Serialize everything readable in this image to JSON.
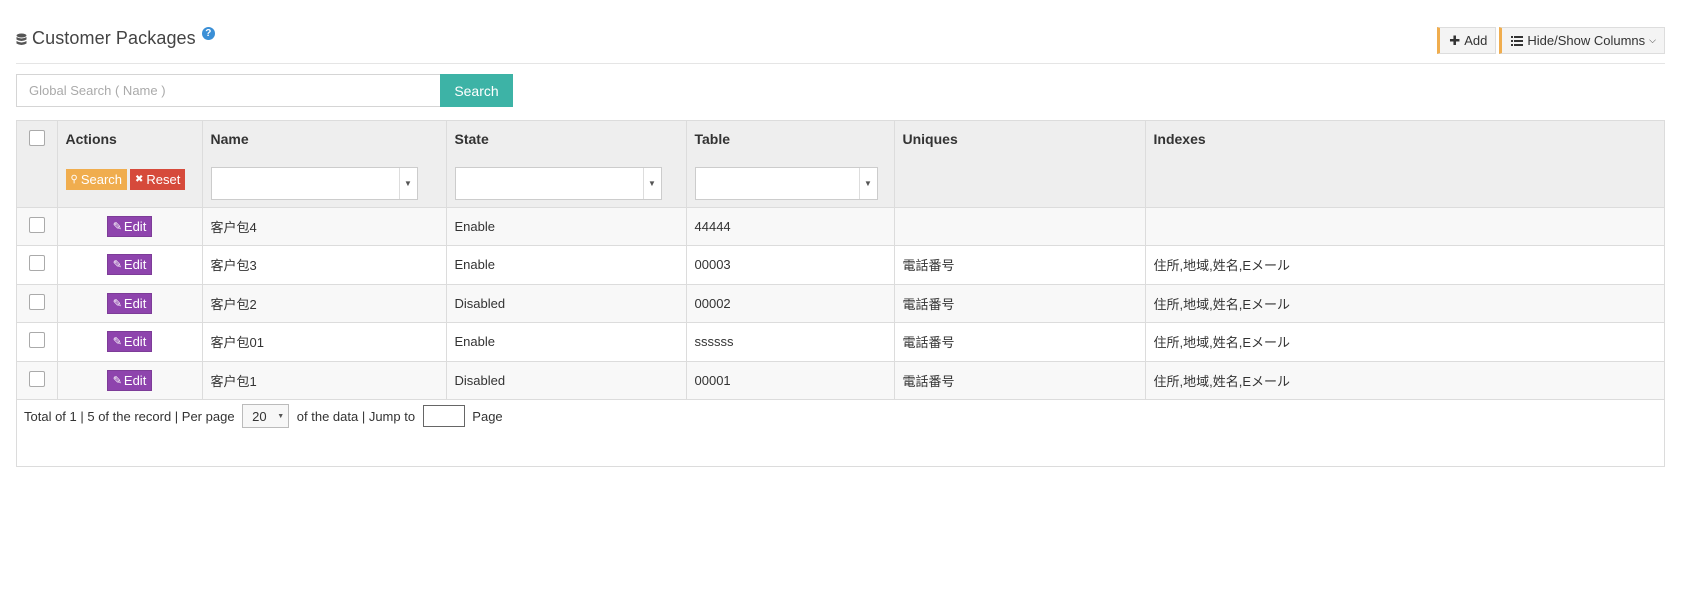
{
  "header": {
    "title": "Customer Packages",
    "help_symbol": "?",
    "add_label": "Add",
    "columns_label": "Hide/Show Columns"
  },
  "search": {
    "placeholder": "Global Search ( Name )",
    "button_label": "Search"
  },
  "table": {
    "columns": {
      "actions": "Actions",
      "name": "Name",
      "state": "State",
      "table": "Table",
      "uniques": "Uniques",
      "indexes": "Indexes"
    },
    "filter_search_label": "Search",
    "filter_reset_label": "Reset",
    "edit_label": "Edit",
    "rows": [
      {
        "name": "客户包4",
        "state": "Enable",
        "table": "44444",
        "uniques": "",
        "indexes": ""
      },
      {
        "name": "客户包3",
        "state": "Enable",
        "table": "00003",
        "uniques": "電話番号",
        "indexes": "住所,地域,姓名,Eメール"
      },
      {
        "name": "客户包2",
        "state": "Disabled",
        "table": "00002",
        "uniques": "電話番号",
        "indexes": "住所,地域,姓名,Eメール"
      },
      {
        "name": "客户包01",
        "state": "Enable",
        "table": "ssssss",
        "uniques": "電話番号",
        "indexes": "住所,地域,姓名,Eメール"
      },
      {
        "name": "客户包1",
        "state": "Disabled",
        "table": "00001",
        "uniques": "電話番号",
        "indexes": "住所,地域,姓名,Eメール"
      }
    ]
  },
  "pager": {
    "total_text": "Total of 1 | 5 of the record | Per page ",
    "per_page_value": "20",
    "of_data_text": " of the data | Jump to ",
    "page_text": " Page"
  },
  "colors": {
    "accent_teal": "#3db3a6",
    "edit_purple": "#8e44ad",
    "search_orange": "#f0ad4e",
    "reset_red": "#d64a3b",
    "help_blue": "#3a8fd6"
  }
}
